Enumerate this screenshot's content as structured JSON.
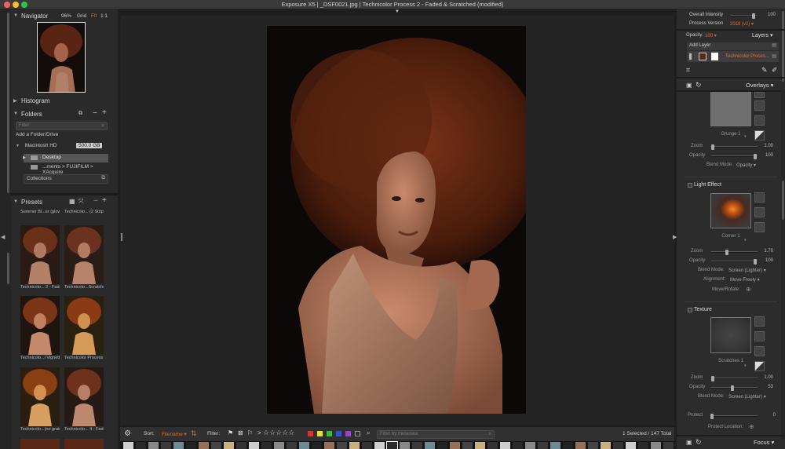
{
  "window": {
    "title": "Exposure X5 | _DSF0021.jpg | Technicolor Process 2 - Faded & Scratched (modified)"
  },
  "navigator": {
    "label": "Navigator",
    "zoom": "96%",
    "grid": "Grid",
    "fit": "Fit",
    "one_to_one": "1:1"
  },
  "histogram": {
    "label": "Histogram"
  },
  "folders": {
    "label": "Folders",
    "filter_placeholder": "Filter",
    "add_folder": "Add a Folder/Drive",
    "drive": "Macintosh HD",
    "drive_size": "500.0 GB",
    "items": [
      "Desktop",
      "...ments > FUJIFILM > XAcquire"
    ],
    "collections": "Collections"
  },
  "presets": {
    "label": "Presets",
    "items": [
      "Summer Bl...er (glow)",
      "Technicolo... (2 Strip)",
      "Technicolo... 2 - Faded",
      "Technicolo...Scratched",
      "Technicolo...l Vignette",
      "Technicolor Process 4",
      "Technicolo...(no grain)",
      "Technicolo... 4 - Faded"
    ]
  },
  "bottombar": {
    "sort_label": "Sort:",
    "sort_value": "Filename",
    "filter_label": "Filter:",
    "metadata_placeholder": "Filter by metadata",
    "selection": "1 Selected / 147 Total",
    "colors": [
      "#e03030",
      "#e8e020",
      "#30c030",
      "#3050e0",
      "#a040d0"
    ]
  },
  "right": {
    "overall_intensity_label": "Overall Intensity",
    "overall_intensity_value": "100",
    "process_version_label": "Process Version",
    "process_version_value": "2018 (v2)",
    "opacity_label": "Opacity:",
    "opacity_value": "100",
    "layers": "Layers",
    "add_layer": "Add Layer",
    "layer_name": "Technicolor Proces...",
    "overlays": "Overlays",
    "grunge": {
      "name": "Grunge",
      "index": "1",
      "zoom_label": "Zoom",
      "zoom_value": "1.00",
      "opacity_label": "Opacity",
      "opacity_value": "100",
      "blend_label": "Blend Mode:",
      "blend_value": "Opacity"
    },
    "light_effect": {
      "title": "Light Effect",
      "name": "Corner",
      "index": "1",
      "zoom_label": "Zoom",
      "zoom_value": "1.70",
      "opacity_label": "Opacity",
      "opacity_value": "100",
      "blend_label": "Blend Mode:",
      "blend_value": "Screen (Lighter)",
      "alignment_label": "Alignment:",
      "alignment_value": "Move Freely",
      "move_rotate": "Move/Rotate:"
    },
    "texture": {
      "title": "Texture",
      "name": "Scratches",
      "index": "1",
      "zoom_label": "Zoom",
      "zoom_value": "1.00",
      "opacity_label": "Opacity",
      "opacity_value": "53",
      "blend_label": "Blend Mode:",
      "blend_value": "Screen (Lighter)",
      "protect_label": "Protect",
      "protect_value": "0",
      "protect_location": "Protect Location:"
    },
    "focus": "Focus"
  }
}
